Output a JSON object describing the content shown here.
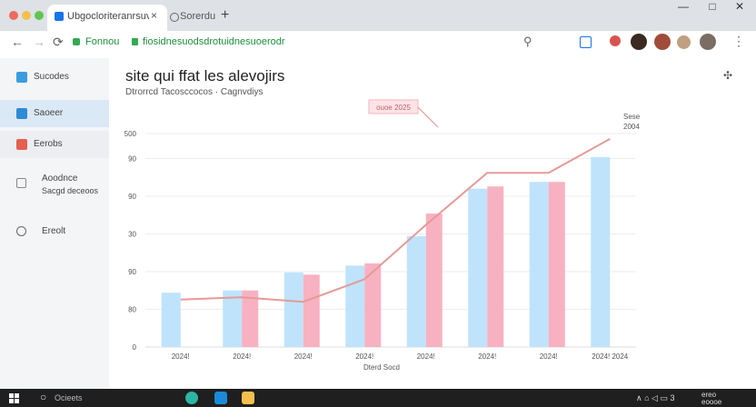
{
  "browser": {
    "tab_title": "Ubgocloriteranrsuvtitkes",
    "tab_close": "×",
    "second_tab_title": "Sorerdu",
    "new_tab": "+",
    "window_controls": {
      "minimize": "—",
      "maximize": "□",
      "close": "✕"
    },
    "nav": {
      "back": "←",
      "forward": "→",
      "reload": "⟳"
    },
    "bookmark_label": "Fonnou",
    "url": "fiosidnesuodsdrotuidnesuoerodr",
    "zoom": "⚲",
    "menu": "⋮"
  },
  "sidebar": {
    "items": [
      {
        "label": "Sucodes",
        "icon": "chat-icon",
        "color": "#3b9ddd"
      },
      {
        "label": "Saoeer",
        "icon": "check-icon",
        "color": "#2e8bd4",
        "active": true
      },
      {
        "label": "Eerobs",
        "icon": "flag-icon",
        "color": "#e5604f"
      },
      {
        "label": "Aoodnce",
        "sublabel": "Sacgd deceoos",
        "icon": "document-icon",
        "color": "#888888"
      },
      {
        "label": "Ereolt",
        "icon": "users-icon",
        "color": "#666666"
      }
    ]
  },
  "page": {
    "title": "site qui ffat les alevojirs",
    "subtitle": "Dtrorrcd Tacosccocos  ·  Cagnvdiys",
    "settings": "✣"
  },
  "chart_data": {
    "type": "bar",
    "categories": [
      "2024!",
      "2024!",
      "2024!",
      "2024!",
      "2024!",
      "2024!",
      "2024!",
      "2024! 2024"
    ],
    "series": [
      {
        "color": "#bfe3fb",
        "values": [
          120,
          125,
          165,
          180,
          245,
          350,
          365,
          420
        ]
      },
      {
        "color": "#f8b1c1",
        "values": [
          null,
          125,
          160,
          185,
          295,
          355,
          365,
          null
        ]
      },
      {
        "type": "line",
        "color": "#e59a98",
        "values": [
          105,
          110,
          100,
          150,
          270,
          385,
          385,
          460
        ]
      }
    ],
    "ylim": [
      0,
      500
    ],
    "ytick_labels": [
      "0",
      "80",
      "90",
      "30",
      "90",
      "90",
      "500"
    ],
    "xlabel": "Dterd Socd",
    "annotation": "ouoe 2025",
    "side_labels": [
      "Sese",
      "2004"
    ],
    "grid": true
  },
  "taskbar": {
    "search_label": "Ocieets",
    "tray_text": "∧ ⌂ ◁ ▭ 3",
    "clock_time": "ereo",
    "clock_date": "eoooe",
    "apps": [
      {
        "icon": "edge-icon",
        "color": "#2bb6a3"
      },
      {
        "icon": "store-icon",
        "color": "#1c8ad8"
      },
      {
        "icon": "folder-icon",
        "color": "#f3c04d"
      }
    ]
  },
  "colors": {
    "accent": "#1a73e8",
    "sidebar_active": "#dbe8f6"
  }
}
